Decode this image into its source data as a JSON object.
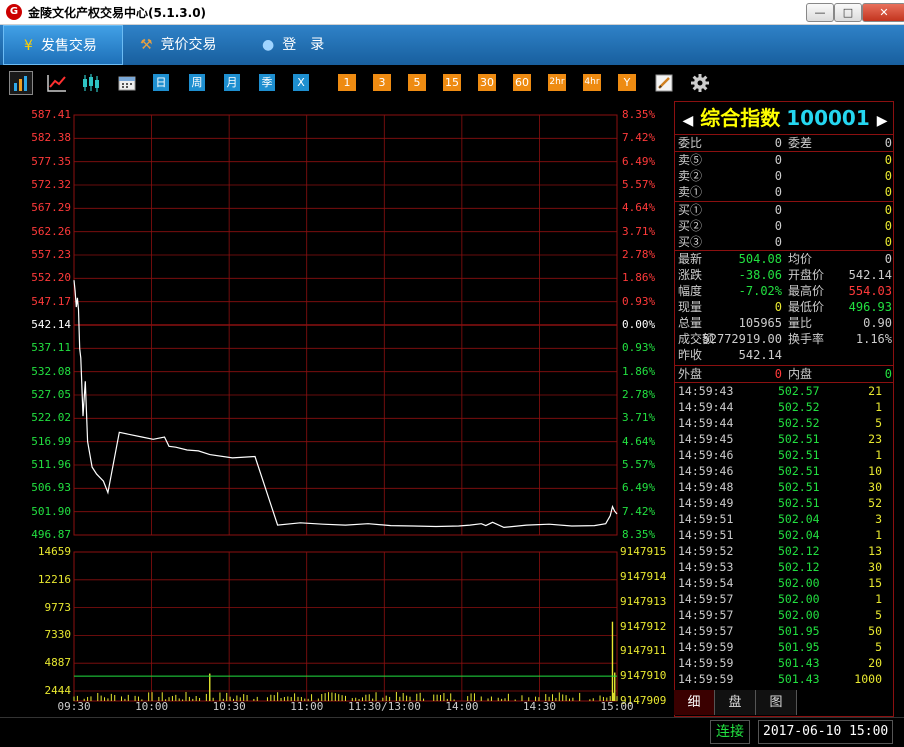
{
  "window": {
    "title": "金陵文化产权交易中心(5.1.3.0)",
    "min_label": "—",
    "max_label": "□",
    "close_label": "✕"
  },
  "nav": {
    "tabs": [
      {
        "label": "发售交易",
        "icon": "yen-icon"
      },
      {
        "label": "竞价交易",
        "icon": "gavel-icon"
      },
      {
        "label": "登　录",
        "icon": "user-icon"
      }
    ]
  },
  "toolbar": {
    "chart_icons": [
      "bar-chart-icon",
      "line-chart-icon",
      "candlestick-icon",
      "calendar-icon"
    ],
    "period_buttons": [
      "日",
      "周",
      "月",
      "季",
      "X"
    ],
    "minute_buttons": [
      "1",
      "3",
      "5",
      "15",
      "30",
      "60",
      "2hr",
      "4hr",
      "Y"
    ],
    "tool_icons": [
      "draw-icon",
      "gear-icon"
    ]
  },
  "chart_data": {
    "type": "line",
    "title": "",
    "price_axis": {
      "ticks": [
        "587.41",
        "582.38",
        "577.35",
        "572.32",
        "567.29",
        "562.26",
        "557.23",
        "552.20",
        "547.17",
        "542.14",
        "537.11",
        "532.08",
        "527.05",
        "522.02",
        "516.99",
        "511.96",
        "506.93",
        "501.90",
        "496.87"
      ],
      "ylim": [
        496.87,
        587.41
      ],
      "base": 542.14
    },
    "pct_axis": {
      "ticks": [
        "8.35%",
        "7.42%",
        "6.49%",
        "5.57%",
        "4.64%",
        "3.71%",
        "2.78%",
        "1.86%",
        "0.93%",
        "0.00%",
        "0.93%",
        "1.86%",
        "2.78%",
        "3.71%",
        "4.64%",
        "5.57%",
        "6.49%",
        "7.42%",
        "8.35%"
      ]
    },
    "volume_axis": {
      "ticks": [
        "14659",
        "12216",
        "9773",
        "7330",
        "4887",
        "2444"
      ],
      "ylim": [
        0,
        14659
      ]
    },
    "open_interest_axis": {
      "ticks": [
        "9147915",
        "9147914",
        "9147913",
        "9147912",
        "9147911",
        "9147910",
        "9147909"
      ]
    },
    "x_ticks": [
      "09:30",
      "10:00",
      "10:30",
      "11:00",
      "11:30/13:00",
      "14:00",
      "14:30",
      "15:00"
    ],
    "price_series": {
      "name": "",
      "x": [
        0,
        0.5,
        1,
        1.5,
        2,
        2.5,
        3,
        4,
        5,
        6,
        8,
        10,
        13,
        15,
        20,
        25,
        30,
        35,
        40,
        42,
        45,
        50,
        55,
        60,
        70,
        80,
        90,
        100,
        110,
        120,
        130,
        140,
        150,
        160,
        170,
        175,
        180,
        182,
        185,
        190,
        200,
        210,
        220,
        230,
        235,
        237,
        238,
        239,
        240
      ],
      "y": [
        551.8,
        549.5,
        546.0,
        548.0,
        545.5,
        537.0,
        535.0,
        522.5,
        530.0,
        517.0,
        511.5,
        510.0,
        508.5,
        506.0,
        519.0,
        518.5,
        518.0,
        517.5,
        518.0,
        516.0,
        515.8,
        515.2,
        515.0,
        514.2,
        513.5,
        513.8,
        499.0,
        499.5,
        499.2,
        499.0,
        499.3,
        498.9,
        498.8,
        498.7,
        498.8,
        499.0,
        499.3,
        498.9,
        499.6,
        498.5,
        499.0,
        499.2,
        498.8,
        498.9,
        499.3,
        501.0,
        503.0,
        502.0,
        501.4
      ]
    },
    "volume_series": {
      "name": "",
      "spikes": [
        {
          "minute": 60,
          "value": 2700
        },
        {
          "minute": 238,
          "value": 7800
        },
        {
          "minute": 239,
          "value": 2800
        }
      ],
      "baseline_max": 900
    },
    "open_interest_level": 2444,
    "grid": true
  },
  "quote": {
    "name": "综合指数",
    "code": "100001",
    "arrow_left": "◀",
    "arrow_right": "▶",
    "ratio": {
      "label1": "委比",
      "v1": "0",
      "label2": "委差",
      "v2": "0"
    },
    "asks": [
      {
        "label": "卖⑤",
        "price": "0",
        "vol": "0"
      },
      {
        "label": "卖②",
        "price": "0",
        "vol": "0"
      },
      {
        "label": "卖①",
        "price": "0",
        "vol": "0"
      }
    ],
    "bids": [
      {
        "label": "买①",
        "price": "0",
        "vol": "0"
      },
      {
        "label": "买②",
        "price": "0",
        "vol": "0"
      },
      {
        "label": "买③",
        "price": "0",
        "vol": "0"
      }
    ],
    "stats": [
      {
        "l1": "最新",
        "v1": "504.08",
        "l2": "均价",
        "v2": "0"
      },
      {
        "l1": "涨跌",
        "v1": "-38.06",
        "l2": "开盘价",
        "v2": "542.14"
      },
      {
        "l1": "幅度",
        "v1": "-7.02%",
        "l2": "最高价",
        "v2": "554.03"
      },
      {
        "l1": "现量",
        "v1": "0",
        "l2": "最低价",
        "v2": "496.93"
      },
      {
        "l1": "总量",
        "v1": "105965",
        "l2": "量比",
        "v2": "0.90"
      },
      {
        "l1": "成交额",
        "v1": "52772919.00",
        "l2": "换手率",
        "v2": "1.16%"
      },
      {
        "l1": "昨收",
        "v1": "542.14",
        "l2": "",
        "v2": ""
      }
    ],
    "outer": {
      "l1": "外盘",
      "v1": "0",
      "l2": "内盘",
      "v2": "0"
    }
  },
  "ticks": [
    [
      "14:59:43",
      "502.57",
      "21"
    ],
    [
      "14:59:44",
      "502.52",
      "1"
    ],
    [
      "14:59:44",
      "502.52",
      "5"
    ],
    [
      "14:59:45",
      "502.51",
      "23"
    ],
    [
      "14:59:46",
      "502.51",
      "1"
    ],
    [
      "14:59:46",
      "502.51",
      "10"
    ],
    [
      "14:59:48",
      "502.51",
      "30"
    ],
    [
      "14:59:49",
      "502.51",
      "52"
    ],
    [
      "14:59:51",
      "502.04",
      "3"
    ],
    [
      "14:59:51",
      "502.04",
      "1"
    ],
    [
      "14:59:52",
      "502.12",
      "13"
    ],
    [
      "14:59:53",
      "502.12",
      "30"
    ],
    [
      "14:59:54",
      "502.00",
      "15"
    ],
    [
      "14:59:57",
      "502.00",
      "1"
    ],
    [
      "14:59:57",
      "502.00",
      "5"
    ],
    [
      "14:59:57",
      "501.95",
      "50"
    ],
    [
      "14:59:59",
      "501.95",
      "5"
    ],
    [
      "14:59:59",
      "501.43",
      "20"
    ],
    [
      "14:59:59",
      "501.43",
      "1000"
    ]
  ],
  "bottom_tabs": [
    "细",
    "盘",
    "图"
  ],
  "status": {
    "connection": "连接",
    "datetime": "2017-06-10 15:00"
  },
  "colors": {
    "up": "#ff3a3a",
    "down": "#22e040",
    "grid": "#8b1010",
    "line": "#ffffff",
    "volume": "#e8e830"
  }
}
